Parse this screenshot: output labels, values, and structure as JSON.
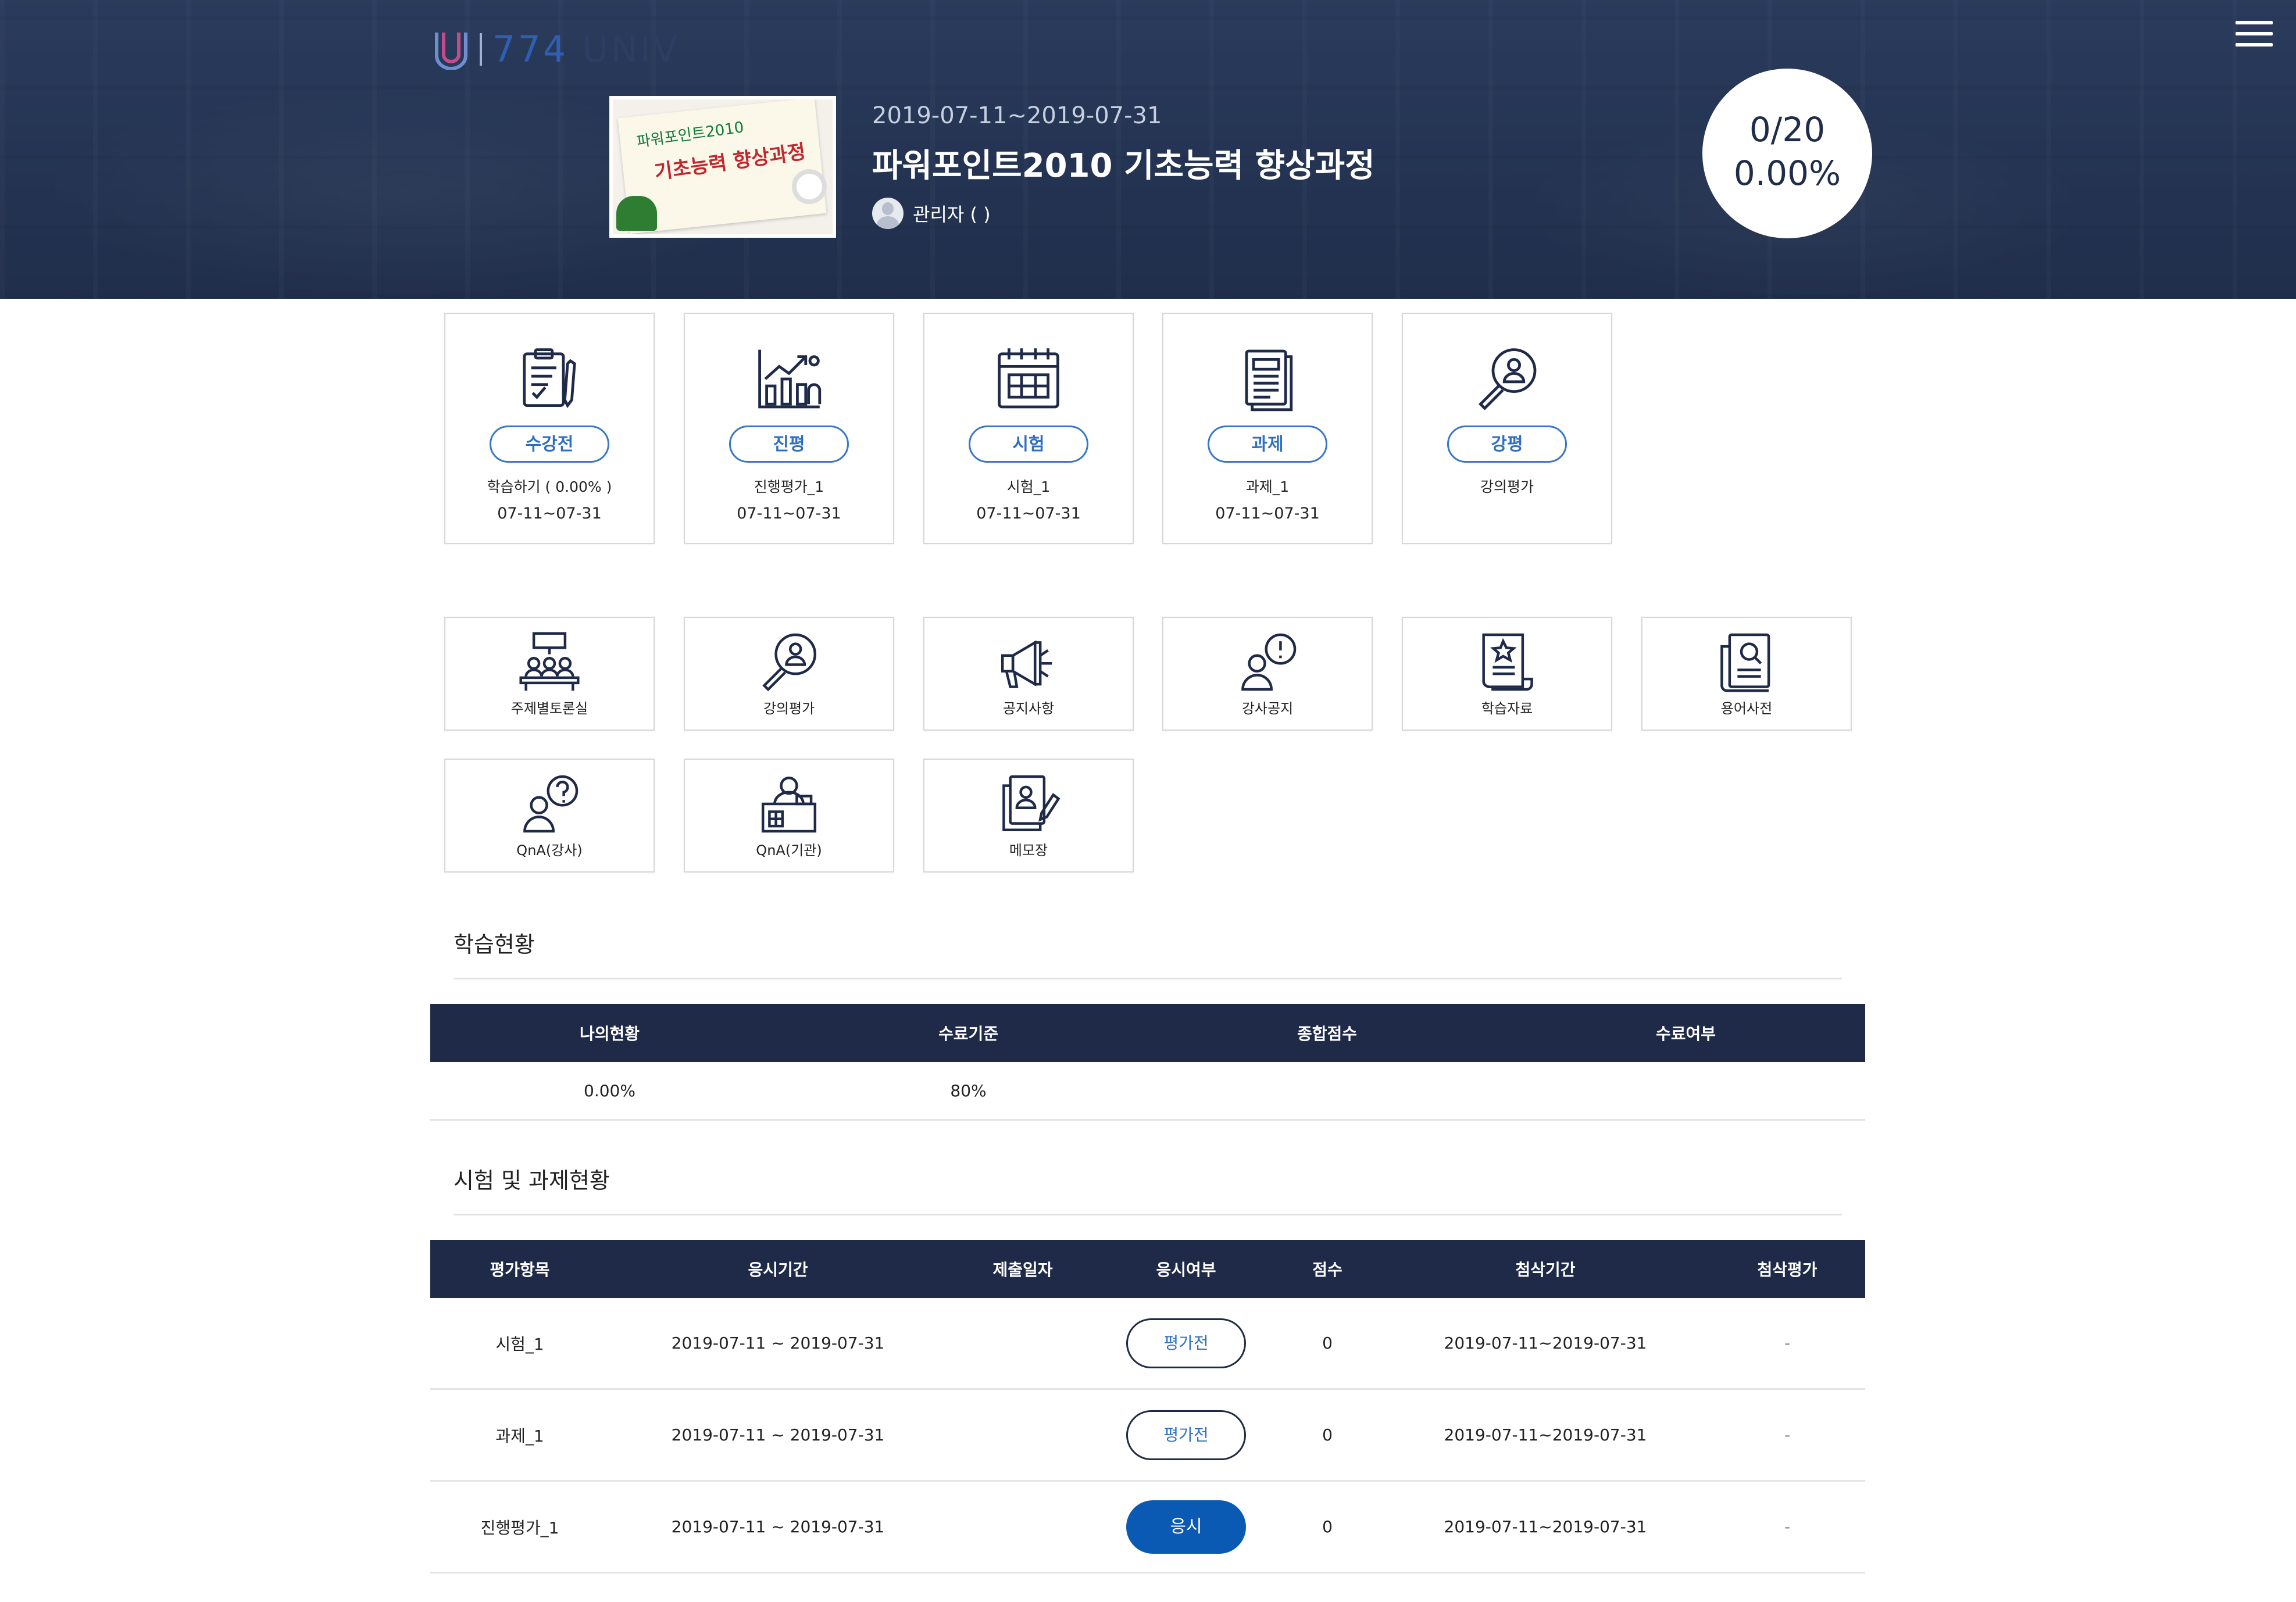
{
  "header": {
    "logo_number": "774",
    "logo_suffix": "UNIV",
    "course": {
      "period": "2019-07-11~2019-07-31",
      "title": "파워포인트2010 기초능력 향상과정",
      "instructor": "관리자 ( )",
      "thumbnail_line1": "파워포인트2010",
      "thumbnail_line2": "기초능력 향상과정"
    },
    "progress": {
      "count": "0/20",
      "percent": "0.00%"
    }
  },
  "stages": [
    {
      "icon": "clipboard-pen-icon",
      "badge": "수강전",
      "sub": "학습하기 ( 0.00% )",
      "date": "07-11~07-31"
    },
    {
      "icon": "growth-chart-icon",
      "badge": "진평",
      "sub": "진행평가_1",
      "date": "07-11~07-31"
    },
    {
      "icon": "calendar-icon",
      "badge": "시험",
      "sub": "시험_1",
      "date": "07-11~07-31"
    },
    {
      "icon": "document-stack-icon",
      "badge": "과제",
      "sub": "과제_1",
      "date": "07-11~07-31"
    },
    {
      "icon": "search-person-icon",
      "badge": "강평",
      "sub": "강의평가",
      "date": ""
    }
  ],
  "menu": [
    {
      "icon": "discussion-room-icon",
      "label": "주제별토론실"
    },
    {
      "icon": "search-person-icon",
      "label": "강의평가"
    },
    {
      "icon": "megaphone-icon",
      "label": "공지사항"
    },
    {
      "icon": "person-alert-icon",
      "label": "강사공지"
    },
    {
      "icon": "scroll-star-icon",
      "label": "학습자료"
    },
    {
      "icon": "document-search-icon",
      "label": "용어사전"
    },
    {
      "icon": "person-question-icon",
      "label": "QnA(강사)"
    },
    {
      "icon": "agency-person-icon",
      "label": "QnA(기관)"
    },
    {
      "icon": "memo-pen-icon",
      "label": "메모장"
    }
  ],
  "study_status": {
    "title": "학습현황",
    "headers": [
      "나의현황",
      "수료기준",
      "종합점수",
      "수료여부"
    ],
    "row": [
      "0.00%",
      "80%",
      "",
      ""
    ]
  },
  "exam_status": {
    "title": "시험 및 과제현황",
    "headers": [
      "평가항목",
      "응시기간",
      "제출일자",
      "응시여부",
      "점수",
      "첨삭기간",
      "첨삭평가"
    ],
    "rows": [
      {
        "item": "시험_1",
        "period": "2019-07-11 ~ 2019-07-31",
        "submitted": "",
        "action": "평가전",
        "score": "0",
        "review_period": "2019-07-11~2019-07-31",
        "review": "-"
      },
      {
        "item": "과제_1",
        "period": "2019-07-11 ~ 2019-07-31",
        "submitted": "",
        "action": "평가전",
        "score": "0",
        "review_period": "2019-07-11~2019-07-31",
        "review": "-"
      },
      {
        "item": "진행평가_1",
        "period": "2019-07-11 ~ 2019-07-31",
        "submitted": "",
        "action": "응시",
        "score": "0",
        "review_period": "2019-07-11~2019-07-31",
        "review": "-"
      }
    ]
  },
  "colors": {
    "navy": "#1f2a48",
    "accent_blue": "#2f6fc0",
    "button_blue": "#0a59b3"
  }
}
